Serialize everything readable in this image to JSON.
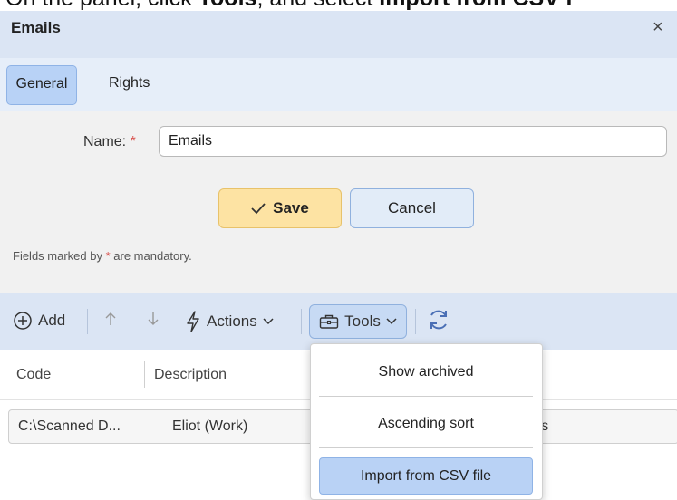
{
  "instruction": {
    "prefix": "On the panel, click ",
    "tools_word": "Tools",
    "middle": ", and select ",
    "import_word": "Import from CSV f"
  },
  "dialog": {
    "title": "Emails",
    "close": "×"
  },
  "tabs": [
    {
      "label": "General",
      "active": true
    },
    {
      "label": "Rights",
      "active": false
    }
  ],
  "form": {
    "name_label": "Name:",
    "required_mark": "*",
    "name_value": "Emails",
    "save_label": "Save",
    "cancel_label": "Cancel",
    "mandatory_prefix": "Fields marked by ",
    "mandatory_suffix": " are mandatory."
  },
  "toolbar": {
    "add_label": "Add",
    "actions_label": "Actions",
    "tools_label": "Tools"
  },
  "table": {
    "columns": [
      "Code",
      "Description"
    ],
    "rows": [
      {
        "code": "C:\\Scanned D...",
        "description": "Eliot (Work)",
        "extra": "sers"
      }
    ]
  },
  "tools_menu": {
    "items": [
      "Show archived",
      "Ascending sort",
      "Import from CSV file"
    ],
    "highlighted": "Import from CSV file"
  },
  "colors": {
    "header_bg": "#dbe5f4",
    "tab_active": "#b8d2f6",
    "save_bg": "#fde3a3",
    "cancel_bg": "#e2ecf8",
    "required": "#d9534f",
    "highlight": "#b9d2f5"
  }
}
